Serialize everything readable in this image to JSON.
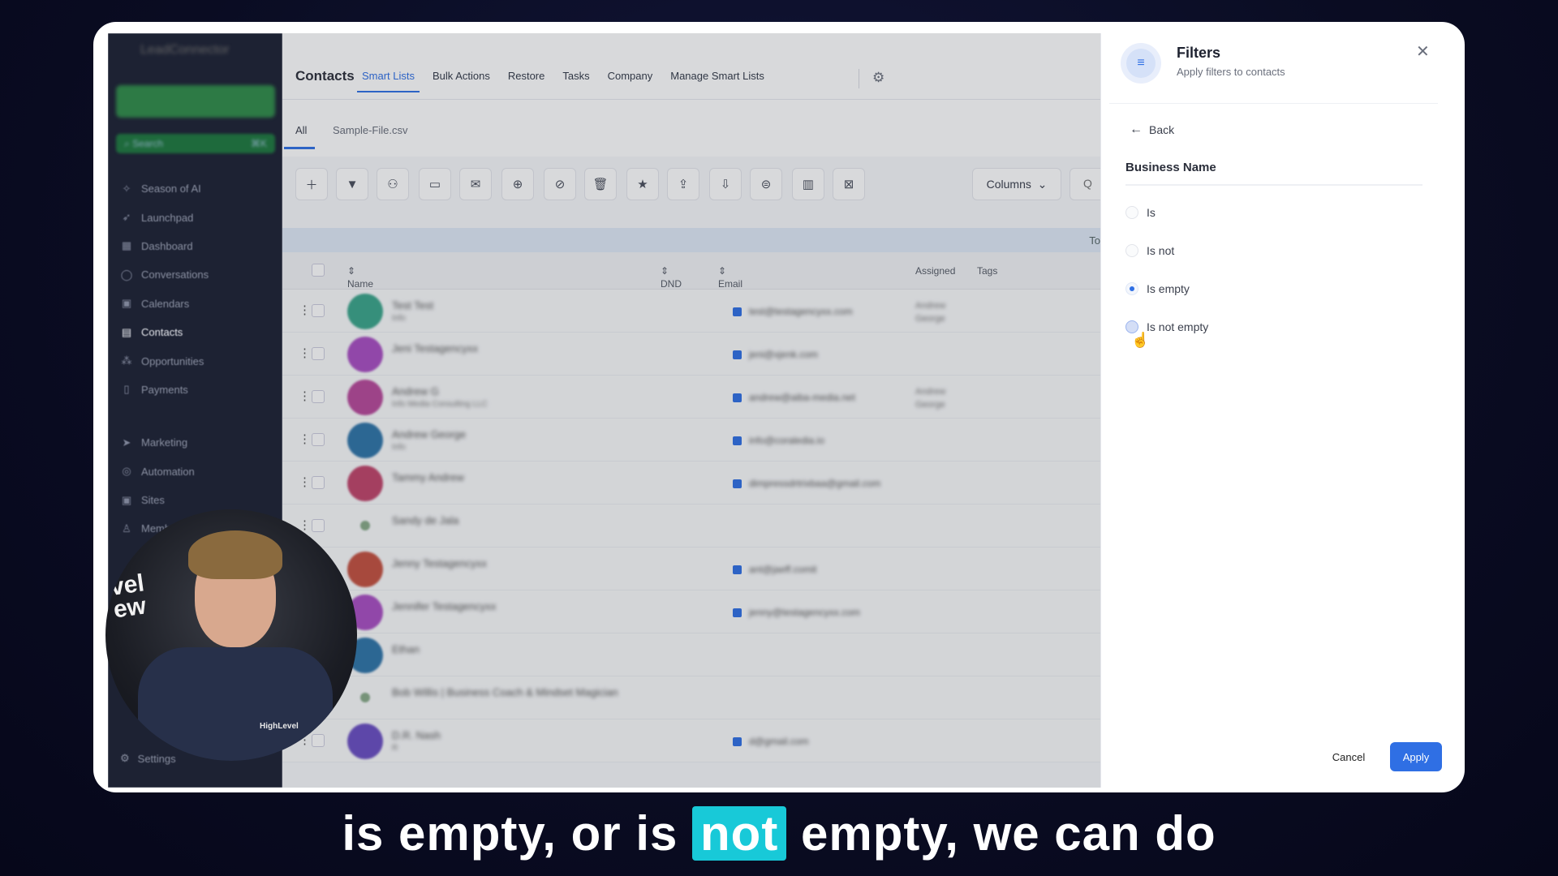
{
  "sidebar": {
    "logo_text": "LeadConnector",
    "search_placeholder": "Search",
    "search_shortcut": "⌘K",
    "items": [
      {
        "label": "Season of AI",
        "icon": "sparkle-icon"
      },
      {
        "label": "Launchpad",
        "icon": "rocket-icon"
      },
      {
        "label": "Dashboard",
        "icon": "dashboard-icon"
      },
      {
        "label": "Conversations",
        "icon": "chat-icon"
      },
      {
        "label": "Calendars",
        "icon": "calendar-icon"
      },
      {
        "label": "Contacts",
        "icon": "contacts-icon",
        "active": true
      },
      {
        "label": "Opportunities",
        "icon": "opportunities-icon"
      },
      {
        "label": "Payments",
        "icon": "payments-icon"
      }
    ],
    "items2": [
      {
        "label": "Marketing",
        "icon": "send-icon"
      },
      {
        "label": "Automation",
        "icon": "automation-icon"
      },
      {
        "label": "Sites",
        "icon": "sites-icon"
      },
      {
        "label": "Memberships",
        "icon": "memberships-icon"
      }
    ],
    "settings_label": "Settings"
  },
  "topnav": {
    "title": "Contacts",
    "links": [
      "Smart Lists",
      "Bulk Actions",
      "Restore",
      "Tasks",
      "Company",
      "Manage Smart Lists"
    ],
    "active_link": "Smart Lists"
  },
  "subtabs": {
    "all": "All",
    "file": "Sample-File.csv"
  },
  "toolbar": {
    "columns_label": "Columns",
    "search_label": "Q",
    "total_label": "To"
  },
  "table": {
    "headers": {
      "name": "Name",
      "dnd": "DND",
      "email": "Email",
      "assigned": "Assigned",
      "tags": "Tags"
    },
    "rows": [
      {
        "name": "Test Test",
        "sub": "Info",
        "email": "test@testagencyxx.com",
        "assigned": "Andrew George",
        "color": "#3aa58a"
      },
      {
        "name": "Jeni Testagencyxx",
        "sub": "",
        "email": "jeni@xjenk.com",
        "assigned": "",
        "color": "#a94ec2"
      },
      {
        "name": "Andrew G",
        "sub": "Info Media Consulting LLC",
        "email": "andrew@aiba-media.net",
        "assigned": "Andrew George",
        "color": "#b8489a"
      },
      {
        "name": "Andrew George",
        "sub": "Info",
        "email": "info@coraledia.io",
        "assigned": "",
        "color": "#2e74a8"
      },
      {
        "name": "Tammy Andrew",
        "sub": "",
        "email": "dimpressdrtrixbaa@gmail.com",
        "assigned": "",
        "color": "#c0446a"
      },
      {
        "name": "Sandy de Jala",
        "sub": "",
        "email": "",
        "assigned": "",
        "color": ""
      },
      {
        "name": "Jenny Testagencyxx",
        "sub": "",
        "email": "ant@jaeff.comit",
        "assigned": "",
        "color": "#c4503f"
      },
      {
        "name": "Jennifer Testagencyxx",
        "sub": "",
        "email": "jenny@testagencyxx.com",
        "assigned": "",
        "color": "#a94ec2"
      },
      {
        "name": "Ethan",
        "sub": "",
        "email": "",
        "assigned": "",
        "color": "#2e74a8"
      },
      {
        "name": "Bob Willis | Business Coach & Mindset Magician",
        "sub": "",
        "email": "",
        "assigned": "",
        "color": ""
      },
      {
        "name": "D.R. Nash",
        "sub": "R",
        "email": "d@gmail.com",
        "assigned": "",
        "color": "#6a4ec2"
      }
    ]
  },
  "filters": {
    "title": "Filters",
    "subtitle": "Apply filters to contacts",
    "back_label": "Back",
    "field_label": "Business Name",
    "options": [
      "Is",
      "Is not",
      "Is empty",
      "Is not empty"
    ],
    "selected_option": "Is empty",
    "hovered_option": "Is not empty",
    "cancel_label": "Cancel",
    "apply_label": "Apply"
  },
  "webcam": {
    "brand": "HighLevel",
    "neon_text": "vel\new"
  },
  "caption": {
    "before": "is empty, or is ",
    "highlight": "not",
    "after": " empty, we can do"
  },
  "colors": {
    "accent": "#2f6fe4",
    "sidebar_bg": "#1d2233",
    "caption_highlight": "#18c9d8"
  }
}
